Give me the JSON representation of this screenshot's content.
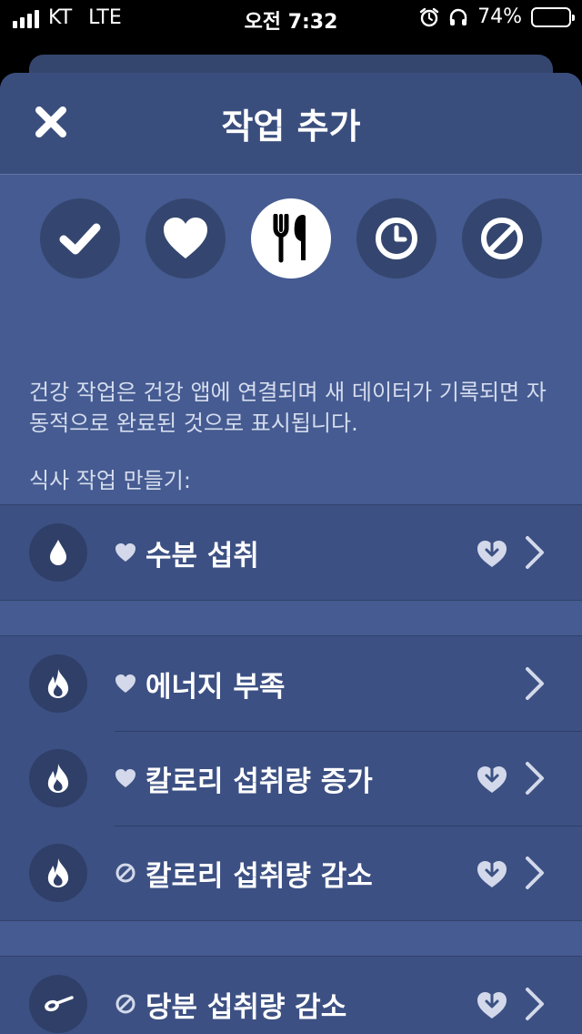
{
  "status_bar": {
    "carrier": "KT",
    "network": "LTE",
    "time": "오전 7:32",
    "battery": "74%",
    "battery_level": 0.74
  },
  "header": {
    "title": "작업 추가",
    "close_icon": "close-icon"
  },
  "categories": [
    {
      "icon": "checkmark-icon",
      "active": false
    },
    {
      "icon": "heart-icon",
      "active": false
    },
    {
      "icon": "fork-knife-icon",
      "active": true
    },
    {
      "icon": "clock-icon",
      "active": false
    },
    {
      "icon": "prohibited-icon",
      "active": false
    }
  ],
  "description": "건강 작업은 건강 앱에 연결되며 새 데이터가 기록되면 자동적으로 완료된 것으로 표시됩니다.",
  "section_label": "식사 작업 만들기:",
  "tasks": [
    {
      "icon": "water-drop-icon",
      "mark": "heart",
      "label": "수분 섭취",
      "download": true
    },
    {
      "icon": "flame-icon",
      "mark": "heart",
      "label": "에너지 부족",
      "download": false
    },
    {
      "icon": "flame-icon",
      "mark": "heart",
      "label": "칼로리 섭취량 증가",
      "download": true
    },
    {
      "icon": "flame-icon",
      "mark": "prohibited",
      "label": "칼로리 섭취량 감소",
      "download": true
    },
    {
      "icon": "spoon-icon",
      "mark": "prohibited",
      "label": "당분 섭취량 감소",
      "download": true
    }
  ],
  "colors": {
    "sheet_background": "#455b91",
    "header_background": "#3a4e7e",
    "row_background": "#3c5083",
    "icon_circle": "#34466f"
  }
}
